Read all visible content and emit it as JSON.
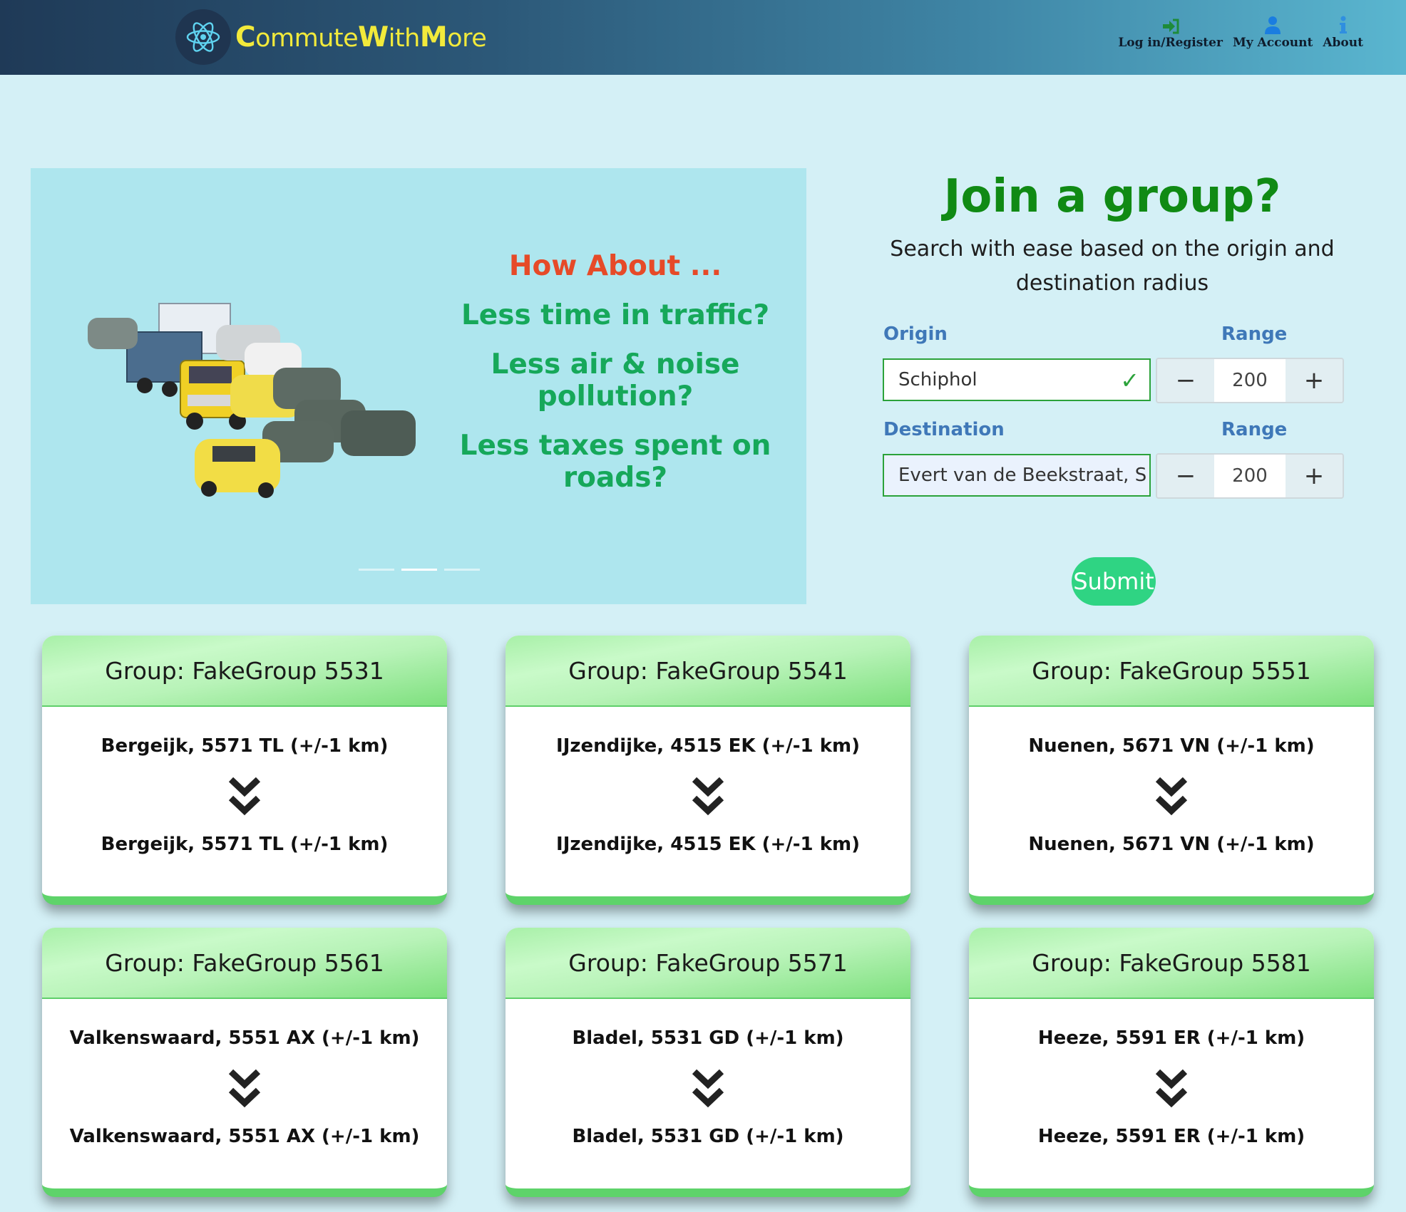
{
  "header": {
    "brand": {
      "p1_cap": "C",
      "p1_rest": "ommute",
      "p2_cap": "W",
      "p2_rest": "ith",
      "p3_cap": "M",
      "p3_rest": "ore"
    },
    "nav": [
      {
        "label": "Log in/Register",
        "icon": "sign-in-icon",
        "color": "#1e8b3a"
      },
      {
        "label": "My Account",
        "icon": "user-icon",
        "color": "#1a7de0"
      },
      {
        "label": "About",
        "icon": "info-icon",
        "color": "#2f8fe0"
      }
    ]
  },
  "carousel": {
    "heading": "How About ...",
    "lines": [
      "Less time in traffic?",
      "Less air & noise pollution?",
      "Less taxes spent on roads?"
    ],
    "slide_count": 3,
    "active_slide": 2
  },
  "search": {
    "title": "Join a group?",
    "subtitle_1": "Search with ease based on the origin and",
    "subtitle_2": "destination radius",
    "origin_label": "Origin",
    "origin_value": "Schiphol",
    "origin_range_label": "Range",
    "origin_range": "200",
    "destination_label": "Destination",
    "destination_value": "Evert van de Beekstraat, S",
    "destination_range_label": "Range",
    "destination_range": "200",
    "minus": "−",
    "plus": "+",
    "submit": "Submit"
  },
  "groups": [
    {
      "title": "Group: FakeGroup 5531",
      "from": "Bergeijk, 5571 TL (+/-1 km)",
      "to": "Bergeijk, 5571 TL (+/-1 km)"
    },
    {
      "title": "Group: FakeGroup 5541",
      "from": "IJzendijke, 4515 EK (+/-1 km)",
      "to": "IJzendijke, 4515 EK (+/-1 km)"
    },
    {
      "title": "Group: FakeGroup 5551",
      "from": "Nuenen, 5671 VN (+/-1 km)",
      "to": "Nuenen, 5671 VN (+/-1 km)"
    },
    {
      "title": "Group: FakeGroup 5561",
      "from": "Valkenswaard, 5551 AX (+/-1 km)",
      "to": "Valkenswaard, 5551 AX (+/-1 km)"
    },
    {
      "title": "Group: FakeGroup 5571",
      "from": "Bladel, 5531 GD (+/-1 km)",
      "to": "Bladel, 5531 GD (+/-1 km)"
    },
    {
      "title": "Group: FakeGroup 5581",
      "from": "Heeze, 5591 ER (+/-1 km)",
      "to": "Heeze, 5591 ER (+/-1 km)"
    }
  ],
  "colors": {
    "accent_green": "#108a14",
    "submit": "#2fd483",
    "brand_yellow": "#f2ea3b",
    "slide_heading": "#e64a28",
    "slide_lines": "#16a85a"
  }
}
